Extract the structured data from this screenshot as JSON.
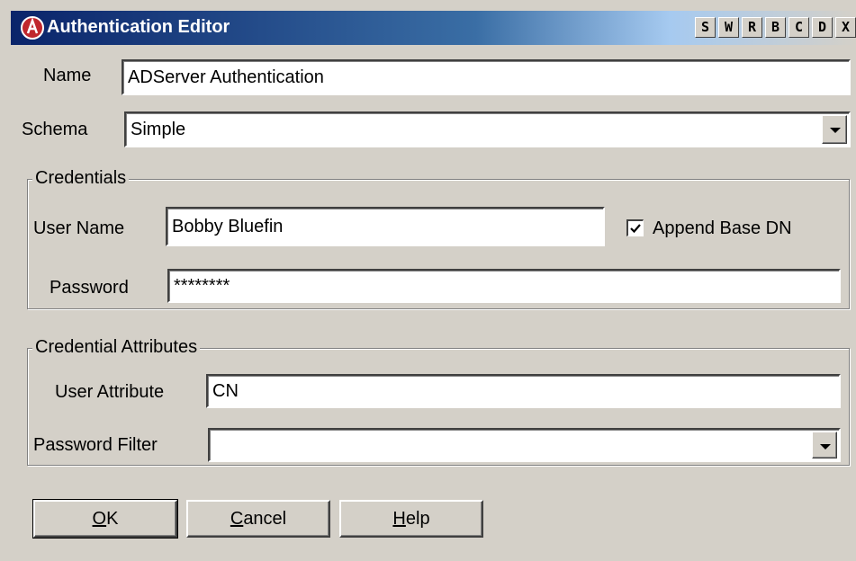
{
  "window": {
    "title": "Authentication Editor",
    "titlebar_buttons": [
      "S",
      "W",
      "R",
      "B",
      "C",
      "D",
      "X"
    ]
  },
  "name": {
    "label": "Name",
    "value": "ADServer Authentication"
  },
  "schema": {
    "label": "Schema",
    "value": "Simple"
  },
  "credentials": {
    "title": "Credentials",
    "user_name_label": "User Name",
    "user_name_value": "Bobby Bluefin",
    "append_base_dn_label": "Append Base DN",
    "append_base_dn_checked": true,
    "password_label": "Password",
    "password_value": "********"
  },
  "credential_attributes": {
    "title": "Credential Attributes",
    "user_attribute_label": "User Attribute",
    "user_attribute_value": "CN",
    "password_filter_label": "Password Filter",
    "password_filter_value": ""
  },
  "buttons": {
    "ok": {
      "mnemonic": "O",
      "rest": "K"
    },
    "cancel": {
      "mnemonic": "C",
      "rest": "ancel"
    },
    "help": {
      "mnemonic": "H",
      "rest": "elp"
    }
  }
}
